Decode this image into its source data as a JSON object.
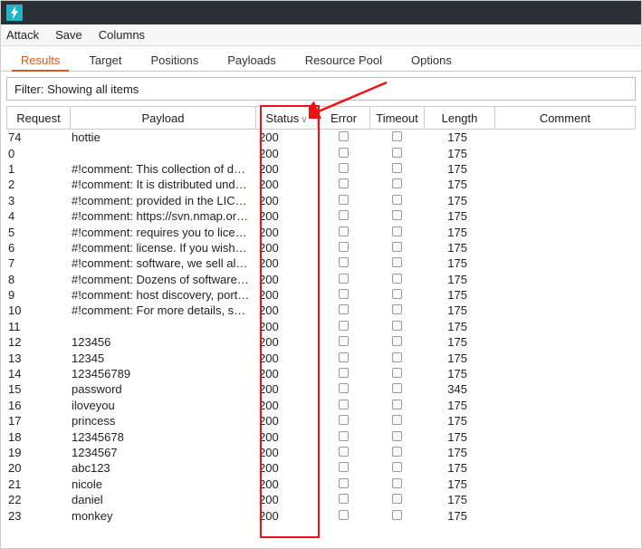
{
  "app": {
    "icon_name": "lightning-icon"
  },
  "menubar": [
    "Attack",
    "Save",
    "Columns"
  ],
  "tabs": [
    {
      "label": "Results",
      "active": true
    },
    {
      "label": "Target",
      "active": false
    },
    {
      "label": "Positions",
      "active": false
    },
    {
      "label": "Payloads",
      "active": false
    },
    {
      "label": "Resource Pool",
      "active": false
    },
    {
      "label": "Options",
      "active": false
    }
  ],
  "filter": {
    "text": "Filter: Showing all items"
  },
  "columns": [
    "Request",
    "Payload",
    "Status",
    "Error",
    "Timeout",
    "Length",
    "Comment"
  ],
  "sort_indicator": "∨",
  "rows": [
    {
      "request": "74",
      "payload": "hottie",
      "status": "200",
      "error": false,
      "timeout": false,
      "length": "175",
      "comment": ""
    },
    {
      "request": "0",
      "payload": "",
      "status": "200",
      "error": false,
      "timeout": false,
      "length": "175",
      "comment": ""
    },
    {
      "request": "1",
      "payload": "#!comment: This collection of d…",
      "status": "200",
      "error": false,
      "timeout": false,
      "length": "175",
      "comment": ""
    },
    {
      "request": "2",
      "payload": "#!comment: It is distributed und…",
      "status": "200",
      "error": false,
      "timeout": false,
      "length": "175",
      "comment": ""
    },
    {
      "request": "3",
      "payload": "#!comment: provided in the LIC…",
      "status": "200",
      "error": false,
      "timeout": false,
      "length": "175",
      "comment": ""
    },
    {
      "request": "4",
      "payload": "#!comment: https://svn.nmap.or…",
      "status": "200",
      "error": false,
      "timeout": false,
      "length": "175",
      "comment": ""
    },
    {
      "request": "5",
      "payload": "#!comment: requires you to lice…",
      "status": "200",
      "error": false,
      "timeout": false,
      "length": "175",
      "comment": ""
    },
    {
      "request": "6",
      "payload": "#!comment: license.  If you wish …",
      "status": "200",
      "error": false,
      "timeout": false,
      "length": "175",
      "comment": ""
    },
    {
      "request": "7",
      "payload": "#!comment: software, we sell al…",
      "status": "200",
      "error": false,
      "timeout": false,
      "length": "175",
      "comment": ""
    },
    {
      "request": "8",
      "payload": "#!comment: Dozens of software…",
      "status": "200",
      "error": false,
      "timeout": false,
      "length": "175",
      "comment": ""
    },
    {
      "request": "9",
      "payload": "#!comment: host discovery, port…",
      "status": "200",
      "error": false,
      "timeout": false,
      "length": "175",
      "comment": ""
    },
    {
      "request": "10",
      "payload": "#!comment: For more details, s…",
      "status": "200",
      "error": false,
      "timeout": false,
      "length": "175",
      "comment": ""
    },
    {
      "request": "11",
      "payload": "",
      "status": "200",
      "error": false,
      "timeout": false,
      "length": "175",
      "comment": ""
    },
    {
      "request": "12",
      "payload": "123456",
      "status": "200",
      "error": false,
      "timeout": false,
      "length": "175",
      "comment": ""
    },
    {
      "request": "13",
      "payload": "12345",
      "status": "200",
      "error": false,
      "timeout": false,
      "length": "175",
      "comment": ""
    },
    {
      "request": "14",
      "payload": "123456789",
      "status": "200",
      "error": false,
      "timeout": false,
      "length": "175",
      "comment": ""
    },
    {
      "request": "15",
      "payload": "password",
      "status": "200",
      "error": false,
      "timeout": false,
      "length": "345",
      "comment": ""
    },
    {
      "request": "16",
      "payload": "iloveyou",
      "status": "200",
      "error": false,
      "timeout": false,
      "length": "175",
      "comment": ""
    },
    {
      "request": "17",
      "payload": "princess",
      "status": "200",
      "error": false,
      "timeout": false,
      "length": "175",
      "comment": ""
    },
    {
      "request": "18",
      "payload": "12345678",
      "status": "200",
      "error": false,
      "timeout": false,
      "length": "175",
      "comment": ""
    },
    {
      "request": "19",
      "payload": "1234567",
      "status": "200",
      "error": false,
      "timeout": false,
      "length": "175",
      "comment": ""
    },
    {
      "request": "20",
      "payload": "abc123",
      "status": "200",
      "error": false,
      "timeout": false,
      "length": "175",
      "comment": ""
    },
    {
      "request": "21",
      "payload": "nicole",
      "status": "200",
      "error": false,
      "timeout": false,
      "length": "175",
      "comment": ""
    },
    {
      "request": "22",
      "payload": "daniel",
      "status": "200",
      "error": false,
      "timeout": false,
      "length": "175",
      "comment": ""
    },
    {
      "request": "23",
      "payload": "monkey",
      "status": "200",
      "error": false,
      "timeout": false,
      "length": "175",
      "comment": ""
    }
  ],
  "annotation": {
    "redbox_label": "Status column highlighted"
  }
}
